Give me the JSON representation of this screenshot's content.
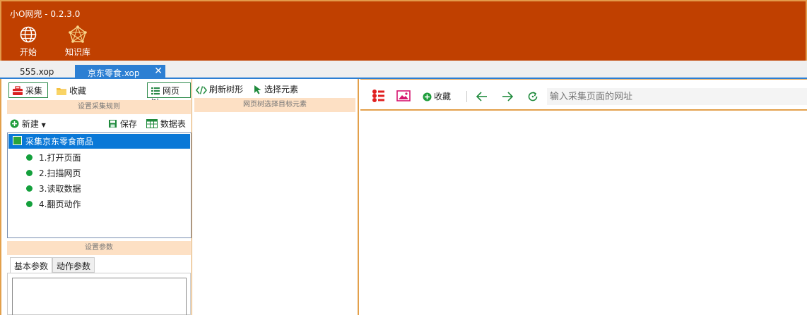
{
  "app": {
    "title": "小O网兜 - 0.2.3.0",
    "accent": "#c04000",
    "tab_accent": "#2c7fd3"
  },
  "ribbon": {
    "start": {
      "label": "开始",
      "icon": "globe-icon"
    },
    "knowledge": {
      "label": "知识库",
      "icon": "network-icon"
    }
  },
  "tabs": [
    {
      "label": "555.xop",
      "active": false
    },
    {
      "label": "京东零食.xop",
      "active": true,
      "close": "✕"
    }
  ],
  "left": {
    "toolbar": {
      "collect": "采集",
      "favorites": "收藏",
      "webtree": "网页树"
    },
    "rules_section": "设置采集规则",
    "rule_toolbar": {
      "new": "新建",
      "save": "保存",
      "datatable": "数据表"
    },
    "tree": {
      "root": "采集京东零食商品",
      "steps": [
        "1.打开页面",
        "2.扫描网页",
        "3.读取数据",
        "4.翻页动作"
      ]
    },
    "params_section": "设置参数",
    "param_tabs": [
      "基本参数",
      "动作参数"
    ]
  },
  "middle": {
    "refresh": "刷新树形",
    "select": "选择元素",
    "section": "网页树选择目标元素"
  },
  "browser": {
    "favorite": "收藏",
    "url_placeholder": "输入采集页面的网址"
  }
}
